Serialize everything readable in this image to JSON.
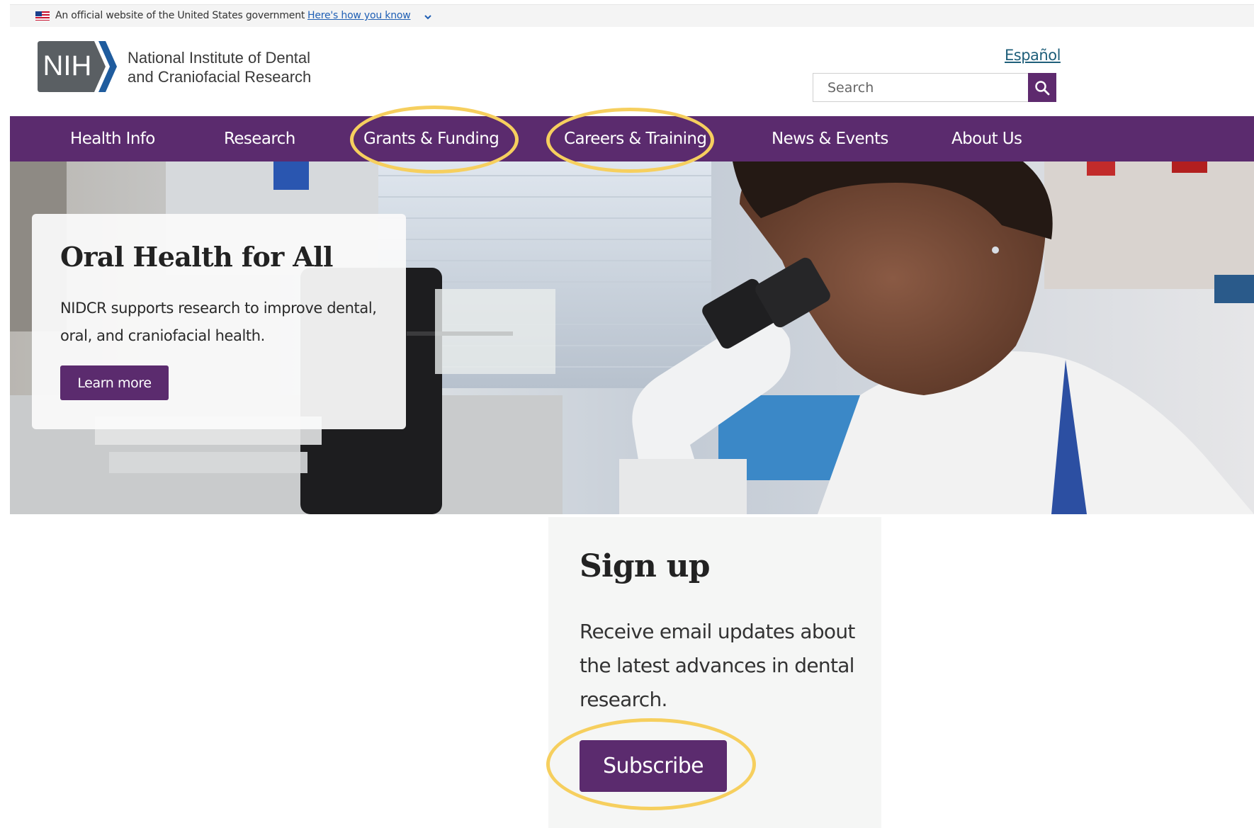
{
  "gov_banner": {
    "text": "An official website of the United States government",
    "link": "Here's how you know",
    "flag_icon": "us-flag-icon",
    "chevron_icon": "chevron-down-icon"
  },
  "header": {
    "logo_text": "NIH",
    "org_name_line1": "National Institute of Dental",
    "org_name_line2": "and Craniofacial Research",
    "language_link": "Español",
    "search": {
      "placeholder": "Search",
      "icon": "search-icon"
    }
  },
  "nav": {
    "items": [
      {
        "label": "Health Info"
      },
      {
        "label": "Research"
      },
      {
        "label": "Grants & Funding",
        "highlighted": true
      },
      {
        "label": "Careers & Training",
        "highlighted": true
      },
      {
        "label": "News & Events"
      },
      {
        "label": "About Us"
      }
    ]
  },
  "hero": {
    "title": "Oral Health for All",
    "text": "NIDCR supports research to improve dental, oral, and craniofacial health.",
    "button": "Learn more"
  },
  "signup": {
    "title": "Sign up",
    "text": "Receive email updates about the latest advances in dental research.",
    "button": "Subscribe",
    "button_highlighted": true
  },
  "colors": {
    "brand_purple": "#5b2b6e",
    "highlight_yellow": "#f6cf5e",
    "link_blue": "#1f5fb4"
  }
}
